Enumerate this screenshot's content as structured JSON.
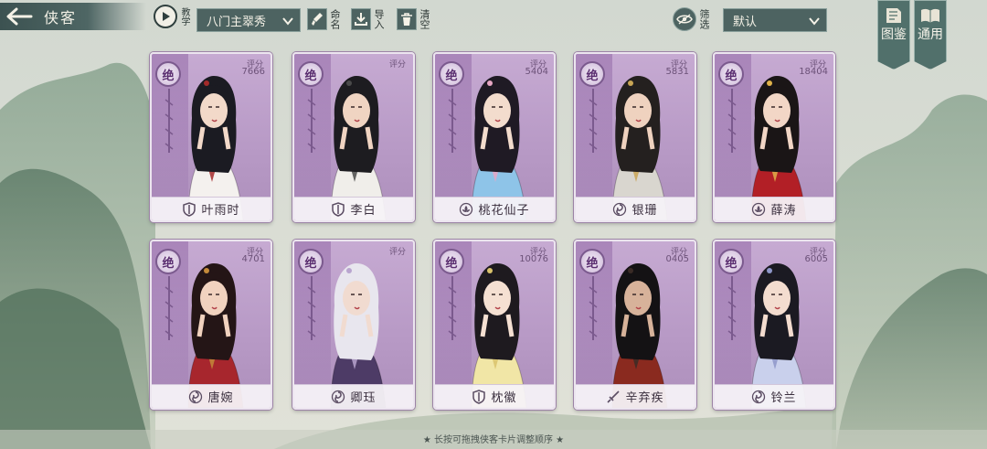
{
  "header": {
    "title": "侠客",
    "tutorial_label": "教学",
    "sect_selected": "八门主翠秀",
    "rename_label": "命名",
    "import_label": "导入",
    "clear_label": "清空",
    "filter_label": "筛选",
    "sort_selected": "默认",
    "atlas_label": "图鉴",
    "general_label": "通用"
  },
  "cards": [
    {
      "rank": "绝",
      "score_label": "评分",
      "score": "7666",
      "name": "叶雨时",
      "faction_icon": "shield-icon"
    },
    {
      "rank": "绝",
      "score_label": "评分",
      "score": "",
      "name": "李白",
      "faction_icon": "shield-icon"
    },
    {
      "rank": "绝",
      "score_label": "评分",
      "score": "5404",
      "name": "桃花仙子",
      "faction_icon": "lotus-icon"
    },
    {
      "rank": "绝",
      "score_label": "评分",
      "score": "5831",
      "name": "银珊",
      "faction_icon": "swirl-icon"
    },
    {
      "rank": "绝",
      "score_label": "评分",
      "score": "18404",
      "name": "薛涛",
      "faction_icon": "lotus-icon"
    },
    {
      "rank": "绝",
      "score_label": "评分",
      "score": "4701",
      "name": "唐婉",
      "faction_icon": "swirl-icon"
    },
    {
      "rank": "绝",
      "score_label": "评分",
      "score": "",
      "name": "卿珏",
      "faction_icon": "swirl-icon"
    },
    {
      "rank": "绝",
      "score_label": "评分",
      "score": "10076",
      "name": "枕徽",
      "faction_icon": "shield-icon"
    },
    {
      "rank": "绝",
      "score_label": "评分",
      "score": "0405",
      "name": "辛弃疾",
      "faction_icon": "sword-icon"
    },
    {
      "rank": "绝",
      "score_label": "评分",
      "score": "6005",
      "name": "铃兰",
      "faction_icon": "swirl-icon"
    }
  ],
  "footer": {
    "hint": "★ 长按可拖拽侠客卡片调整顺序 ★"
  }
}
